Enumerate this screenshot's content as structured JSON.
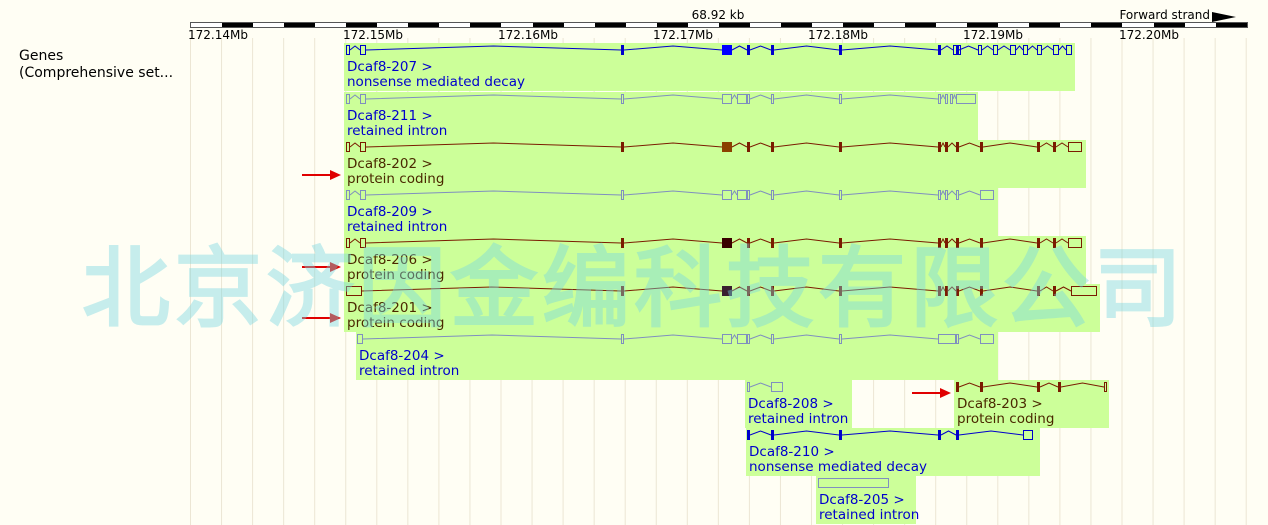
{
  "ruler": {
    "span_label": "68.92 kb",
    "strand_label": "Forward strand",
    "ticks": [
      "172.14Mb",
      "172.15Mb",
      "172.16Mb",
      "172.17Mb",
      "172.18Mb",
      "172.19Mb",
      "172.20Mb"
    ]
  },
  "track": {
    "label_line1": "Genes",
    "label_line2": "(Comprehensive set..."
  },
  "transcripts": [
    {
      "name": "Dcaf8-207 >",
      "biotype": "nonsense mediated decay",
      "kind": "nmd",
      "marked": false
    },
    {
      "name": "Dcaf8-211 >",
      "biotype": "retained intron",
      "kind": "ri",
      "marked": false
    },
    {
      "name": "Dcaf8-202 >",
      "biotype": "protein coding",
      "kind": "pc",
      "marked": true
    },
    {
      "name": "Dcaf8-209 >",
      "biotype": "retained intron",
      "kind": "ri",
      "marked": false
    },
    {
      "name": "Dcaf8-206 >",
      "biotype": "protein coding",
      "kind": "pc",
      "marked": true
    },
    {
      "name": "Dcaf8-201 >",
      "biotype": "protein coding",
      "kind": "pc",
      "marked": true
    },
    {
      "name": "Dcaf8-204 >",
      "biotype": "retained intron",
      "kind": "ri",
      "marked": false
    },
    {
      "name": "Dcaf8-208 >",
      "biotype": "retained intron",
      "kind": "ri",
      "marked": false
    },
    {
      "name": "Dcaf8-203 >",
      "biotype": "protein coding",
      "kind": "pc",
      "marked": true
    },
    {
      "name": "Dcaf8-210 >",
      "biotype": "nonsense mediated decay",
      "kind": "nmd",
      "marked": false
    },
    {
      "name": "Dcaf8-205 >",
      "biotype": "retained intron",
      "kind": "ri",
      "marked": false
    }
  ],
  "watermark": "北京济因金编科技有限公司",
  "colors": {
    "nmd": "#0000cc",
    "retained_intron": "#7f8fbf",
    "protein_coding": "#7a1b00",
    "highlight_arrow": "#e00000",
    "transcript_bg": "#ccff99"
  }
}
